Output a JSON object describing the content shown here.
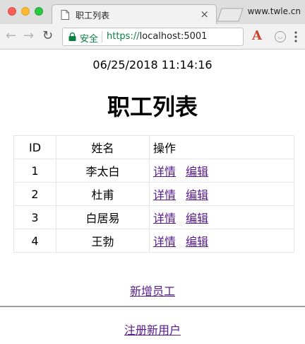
{
  "browser": {
    "tab_title": "职工列表",
    "tab_close": "×",
    "brand": "www.twle.cn",
    "nav": {
      "back": "←",
      "forward": "→",
      "reload": "↻"
    },
    "security_label": "安全",
    "url_scheme": "https://",
    "url_host": "localhost:5001",
    "extension_label": "A",
    "colors": {
      "secure": "#0b8043",
      "extension": "#c9462c",
      "visited_link": "#551a8b"
    }
  },
  "page": {
    "datetime": "06/25/2018 11:14:16",
    "heading": "职工列表",
    "table": {
      "headers": {
        "id": "ID",
        "name": "姓名",
        "operations": "操作"
      },
      "rows": [
        {
          "id": "1",
          "name": "李太白",
          "details": "详情",
          "edit": "编辑"
        },
        {
          "id": "2",
          "name": "杜甫",
          "details": "详情",
          "edit": "编辑"
        },
        {
          "id": "3",
          "name": "白居易",
          "details": "详情",
          "edit": "编辑"
        },
        {
          "id": "4",
          "name": "王勃",
          "details": "详情",
          "edit": "编辑"
        }
      ]
    },
    "add_employee_link": "新增员工",
    "register_link": "注册新用户"
  }
}
